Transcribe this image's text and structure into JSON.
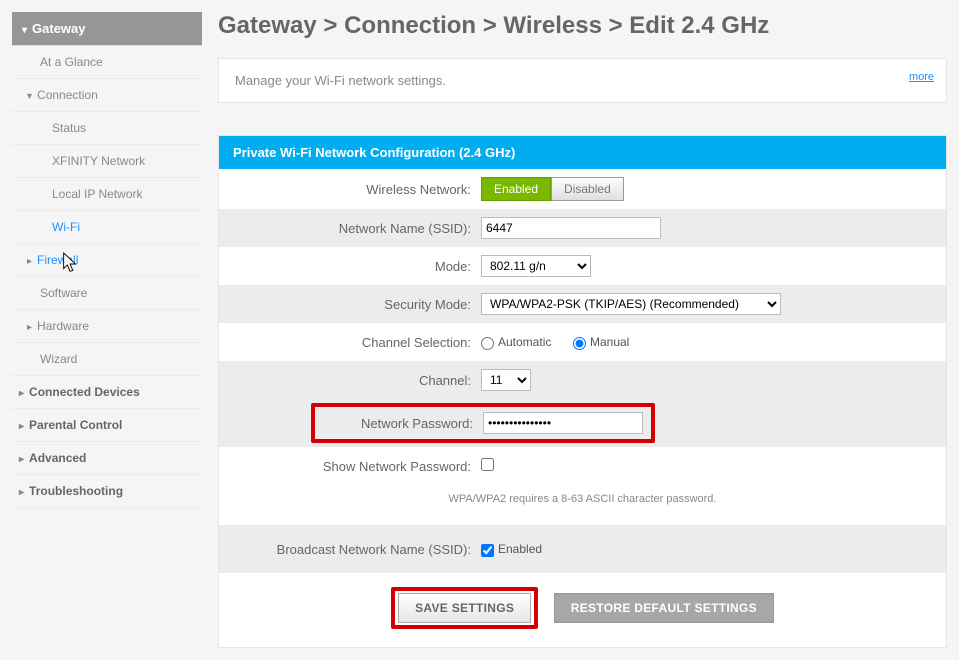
{
  "breadcrumb": "Gateway > Connection > Wireless > Edit 2.4 GHz",
  "info": {
    "text": "Manage your Wi-Fi network settings.",
    "more": "more"
  },
  "sidebar": {
    "header": "Gateway",
    "items": [
      {
        "label": "At a Glance"
      },
      {
        "label": "Connection"
      },
      {
        "label": "Status"
      },
      {
        "label": "XFINITY Network"
      },
      {
        "label": "Local IP Network"
      },
      {
        "label": "Wi-Fi"
      },
      {
        "label": "Firewall"
      },
      {
        "label": "Software"
      },
      {
        "label": "Hardware"
      },
      {
        "label": "Wizard"
      },
      {
        "label": "Connected Devices"
      },
      {
        "label": "Parental Control"
      },
      {
        "label": "Advanced"
      },
      {
        "label": "Troubleshooting"
      }
    ]
  },
  "panel": {
    "title": "Private Wi-Fi Network Configuration (2.4 GHz)",
    "wireless_label": "Wireless Network:",
    "enabled_btn": "Enabled",
    "disabled_btn": "Disabled",
    "ssid_label": "Network Name (SSID):",
    "ssid_value": "6447",
    "mode_label": "Mode:",
    "mode_value": "802.11 g/n",
    "security_label": "Security Mode:",
    "security_value": "WPA/WPA2-PSK (TKIP/AES) (Recommended)",
    "chansel_label": "Channel Selection:",
    "chansel_auto": "Automatic",
    "chansel_manual": "Manual",
    "channel_label": "Channel:",
    "channel_value": "11",
    "pwd_label": "Network Password:",
    "pwd_value": "●●●●●●●●●●●●●●●",
    "showpwd_label": "Show Network Password:",
    "note": "WPA/WPA2 requires a 8-63 ASCII character password.",
    "bcast_label": "Broadcast Network Name (SSID):",
    "bcast_enabled": "Enabled",
    "save_btn": "SAVE SETTINGS",
    "restore_btn": "RESTORE DEFAULT SETTINGS"
  }
}
